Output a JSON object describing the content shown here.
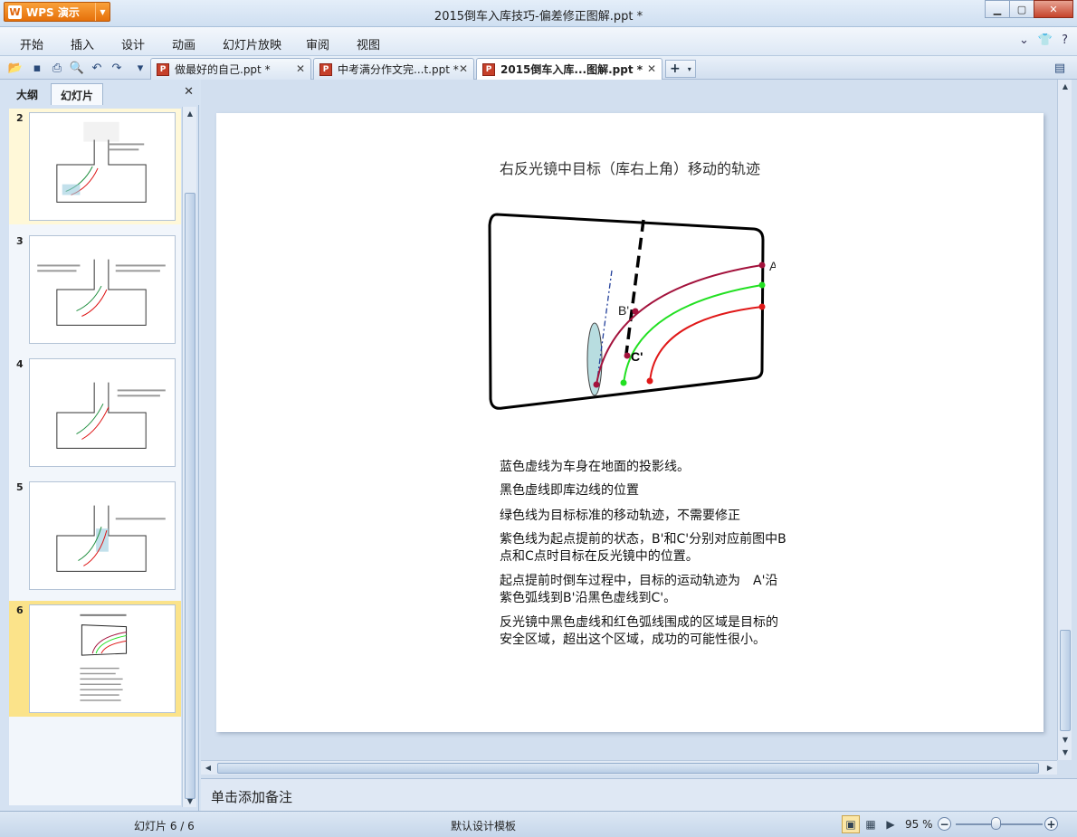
{
  "app": {
    "brand": "WPS 演示",
    "brand_logo": "W",
    "window_title": "2015倒车入库技巧-偏差修正图解.ppt *"
  },
  "menu": {
    "items": [
      "开始",
      "插入",
      "设计",
      "动画",
      "幻灯片放映",
      "审阅",
      "视图"
    ]
  },
  "tabs": [
    {
      "label": "做最好的自己.ppt *",
      "active": false
    },
    {
      "label": "中考满分作文完...t.ppt *",
      "active": false
    },
    {
      "label": "2015倒车入库...图解.ppt *",
      "active": true
    }
  ],
  "left_pane": {
    "tabs": [
      "大纲",
      "幻灯片"
    ],
    "active_tab": "幻灯片",
    "slides": [
      "2",
      "3",
      "4",
      "5",
      "6"
    ],
    "current_slide": "6"
  },
  "slide": {
    "title": "右反光镜中目标（库右上角）移动的轨迹",
    "labels": {
      "a": "A'",
      "b": "B'",
      "c": "C'"
    },
    "paragraphs": [
      "蓝色虚线为车身在地面的投影线。",
      "黑色虚线即库边线的位置",
      "绿色线为目标标准的移动轨迹，不需要修正",
      "紫色线为起点提前的状态，B'和C'分别对应前图中B点和C点时目标在反光镜中的位置。",
      "起点提前时倒车过程中，目标的运动轨迹为　A'沿紫色弧线到B'沿黑色虚线到C'。",
      "反光镜中黑色虚线和红色弧线围成的区域是目标的安全区域，超出这个区域，成功的可能性很小。"
    ]
  },
  "notes": {
    "placeholder": "单击添加备注"
  },
  "status": {
    "slide_counter": "幻灯片 6 / 6",
    "template": "默认设计模板",
    "zoom": "95 %"
  },
  "colors": {
    "purple_arc": "#a3123c",
    "green_arc": "#22e022",
    "red_arc": "#e01818",
    "mirror_fill": "#b8dde0",
    "accent": "#f39a2e"
  }
}
